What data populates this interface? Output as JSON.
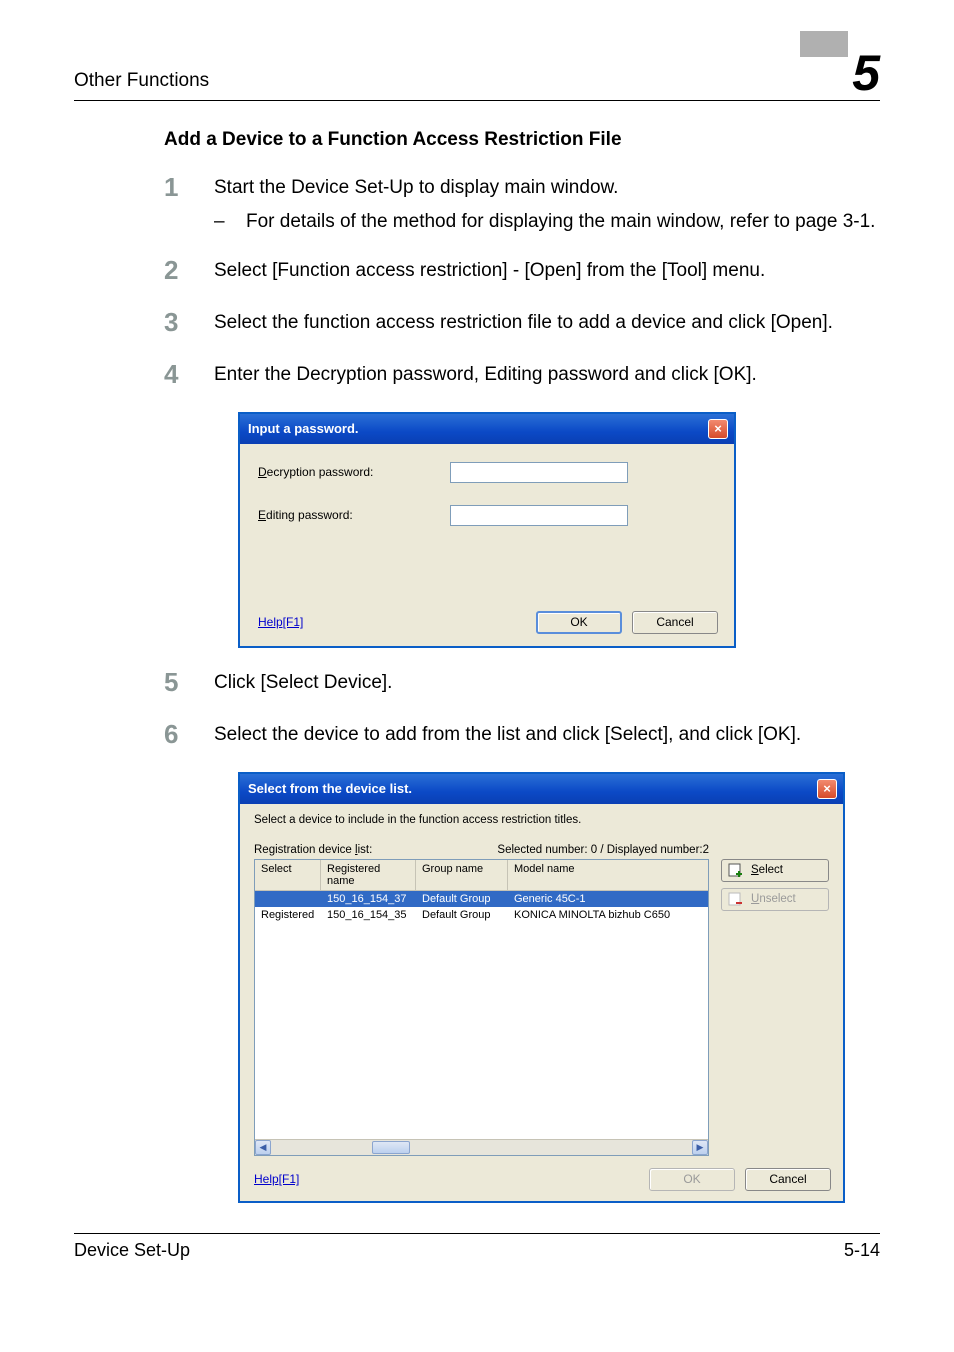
{
  "page": {
    "header": "Other Functions",
    "chapter": "5",
    "section_heading": "Add a Device to a Function Access Restriction File",
    "steps": {
      "s1": {
        "num": "1",
        "text": "Start the Device Set-Up to display main window.",
        "sub": "For details of the method for displaying the main window, refer to page 3-1."
      },
      "s2": {
        "num": "2",
        "text": "Select [Function access restriction] - [Open] from the [Tool] menu."
      },
      "s3": {
        "num": "3",
        "text": "Select the function access restriction file to add a device and click [Open]."
      },
      "s4": {
        "num": "4",
        "text": "Enter the Decryption password, Editing password and click [OK]."
      },
      "s5": {
        "num": "5",
        "text": "Click [Select Device]."
      },
      "s6": {
        "num": "6",
        "text": "Select the device to add from the list and click [Select], and click [OK]."
      }
    },
    "footer_left": "Device Set-Up",
    "footer_right": "5-14"
  },
  "dlg1": {
    "title": "Input a password.",
    "decryption_label_first": "D",
    "decryption_label_rest": "ecryption password:",
    "editing_label_first": "E",
    "editing_label_rest": "diting password:",
    "decryption_value": "",
    "editing_value": "",
    "help": "Help[F1]",
    "ok": "OK",
    "cancel": "Cancel"
  },
  "dlg2": {
    "title": "Select from the device list.",
    "instruction": "Select a device to include in the function access restriction titles.",
    "reg_label_first": "l",
    "reg_label_pre": "Registration device ",
    "reg_label_post": "ist:",
    "counts": "Selected number: 0 / Displayed number:2",
    "headers": {
      "select": "Select",
      "registered": "Registered name",
      "group": "Group name",
      "model": "Model name"
    },
    "rows": [
      {
        "select": "",
        "registered": "150_16_154_37",
        "group": "Default Group",
        "model": "Generic 45C-1"
      },
      {
        "select": "Registered",
        "registered": "150_16_154_35",
        "group": "Default Group",
        "model": "KONICA MINOLTA bizhub C650"
      }
    ],
    "select_btn_first": "S",
    "select_btn_rest": "elect",
    "unselect_btn_first": "U",
    "unselect_btn_rest": "nselect",
    "help": "Help[F1]",
    "ok": "OK",
    "cancel": "Cancel"
  }
}
